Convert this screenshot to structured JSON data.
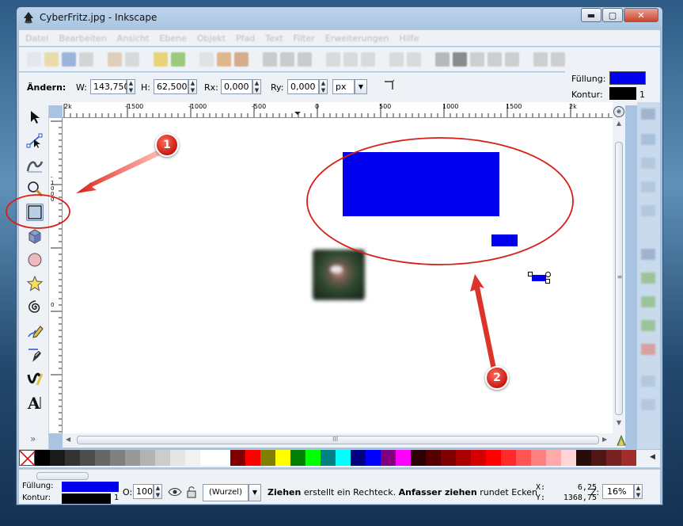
{
  "window": {
    "title": "CyberFritz.jpg - Inkscape",
    "minimize_label": "▬",
    "maximize_label": "▢",
    "close_label": "✕"
  },
  "menubar": {
    "items": [
      "Datei",
      "Bearbeiten",
      "Ansicht",
      "Ebene",
      "Objekt",
      "Pfad",
      "Text",
      "Filter",
      "Erweiterungen",
      "Hilfe"
    ]
  },
  "tool_controls": {
    "mode_label": "Ändern:",
    "w_label": "W:",
    "w_value": "143,750",
    "h_label": "H:",
    "h_value": "62,500",
    "rx_label": "Rx:",
    "rx_value": "0,000",
    "ry_label": "Ry:",
    "ry_value": "0,000",
    "unit_value": "px"
  },
  "style_indicator": {
    "fill_label": "Füllung:",
    "stroke_label": "Kontur:",
    "stroke_width": "1",
    "fill_color": "#0000ee",
    "stroke_color": "#000000"
  },
  "ruler": {
    "h_labels": [
      "2k",
      "-1500",
      "-1000",
      "-500",
      "0",
      "500",
      "1000",
      "1500",
      "2k"
    ],
    "v_labels": [
      "-1000",
      "0"
    ]
  },
  "tools": [
    "selector-tool",
    "node-tool",
    "tweak-tool",
    "zoom-tool",
    "rectangle-tool",
    "3d-box-tool",
    "ellipse-tool",
    "star-tool",
    "spiral-tool",
    "pencil-tool",
    "pen-tool",
    "calligraphy-tool",
    "text-tool"
  ],
  "toolbox_more": "»",
  "palette": {
    "colors": [
      "#000000",
      "#1a1a1a",
      "#333333",
      "#4d4d4d",
      "#666666",
      "#808080",
      "#999999",
      "#b3b3b3",
      "#cccccc",
      "#e6e6e6",
      "#f2f2f2",
      "#ffffff",
      "#ffffff",
      "#800000",
      "#ff0000",
      "#808000",
      "#ffff00",
      "#008000",
      "#00ff00",
      "#008080",
      "#00ffff",
      "#000080",
      "#0000ff",
      "#800080",
      "#ff00ff",
      "#2b0000",
      "#550000",
      "#800000",
      "#aa0000",
      "#d40000",
      "#ff0000",
      "#ff2a2a",
      "#ff5555",
      "#ff8080",
      "#ffaaaa",
      "#ffd5d5",
      "#280b0b",
      "#501616",
      "#782121",
      "#a02c2c"
    ],
    "scroll_right": "◀"
  },
  "status": {
    "fill_label": "Füllung:",
    "stroke_label": "Kontur:",
    "stroke_width": "1",
    "opacity_label": "O:",
    "opacity_value": "100",
    "layer_value": "(Wurzel)",
    "message_bold1": "Ziehen",
    "message_text1": " erstellt ein Rechteck. ",
    "message_bold2": "Anfasser ziehen",
    "message_text2": " rundet Ecken ab u",
    "x_label": "X:",
    "x_value": "6,25",
    "y_label": "Y:",
    "y_value": "1368,75",
    "zoom_label": "Z:",
    "zoom_value": "16%"
  },
  "annotations": {
    "badge_1": "1",
    "badge_2": "2",
    "color": "#d81e14"
  },
  "scroll": {
    "h_grip": "III",
    "v_grip": "≡"
  }
}
